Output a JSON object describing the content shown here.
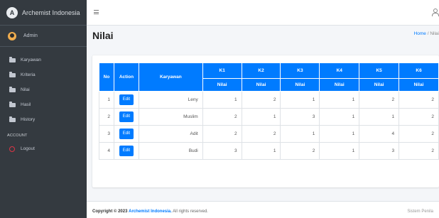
{
  "brand": {
    "name": "Archemist Indonesia",
    "logo_letter": "A"
  },
  "user": {
    "name": "Admin"
  },
  "sidebar": {
    "items": [
      {
        "label": "Karyawan",
        "icon": "folder-icon"
      },
      {
        "label": "Kriteria",
        "icon": "folder-icon"
      },
      {
        "label": "Nilai",
        "icon": "folder-icon"
      },
      {
        "label": "Hasil",
        "icon": "folder-icon"
      },
      {
        "label": "History",
        "icon": "folder-icon"
      }
    ],
    "account_header": "ACCOUNT",
    "logout_label": "Logout"
  },
  "topbar": {
    "menu_icon": "hamburger-icon",
    "user_icon": "user-icon"
  },
  "page": {
    "title": "Nilai",
    "breadcrumb_home": "Home",
    "breadcrumb_sep": "/",
    "breadcrumb_current": "Nilai"
  },
  "table": {
    "headers": {
      "no": "No",
      "action": "Action",
      "karyawan": "Karyawan"
    },
    "criteria": [
      "K1",
      "K2",
      "K3",
      "K4",
      "K5",
      "K6"
    ],
    "sub_label": "Nilai",
    "edit_label": "Edit",
    "rows": [
      {
        "no": "1",
        "name": "Leny",
        "values": [
          "1",
          "2",
          "1",
          "1",
          "2",
          "2"
        ]
      },
      {
        "no": "2",
        "name": "Muslim",
        "values": [
          "2",
          "1",
          "3",
          "1",
          "1",
          "2"
        ]
      },
      {
        "no": "3",
        "name": "Adit",
        "values": [
          "2",
          "2",
          "1",
          "1",
          "4",
          "2"
        ]
      },
      {
        "no": "4",
        "name": "Budi",
        "values": [
          "3",
          "1",
          "2",
          "1",
          "3",
          "2"
        ]
      }
    ]
  },
  "footer": {
    "copyright_prefix": "Copyright © 2023",
    "org": "Archemist Indonesia.",
    "rights": "All rights reserved.",
    "right_text": "Sistem Penila"
  },
  "colors": {
    "primary": "#007bff",
    "sidebar_bg": "#343a40",
    "danger": "#dc3545"
  }
}
